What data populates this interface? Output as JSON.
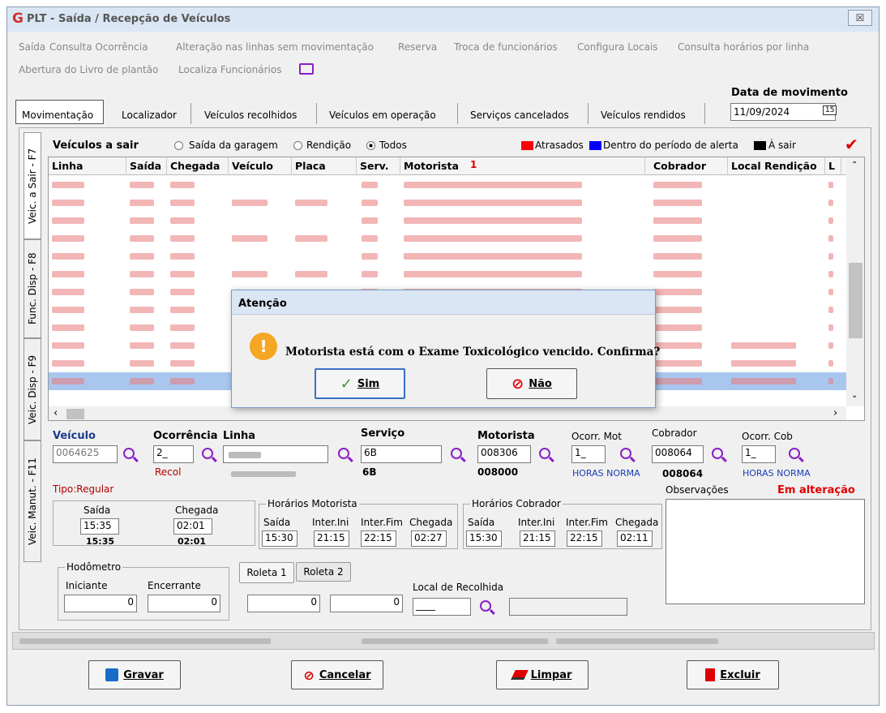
{
  "window": {
    "title": "PLT - Saída / Recepção de Veículos",
    "close": "☒"
  },
  "menu": {
    "row1": [
      "Saída",
      "Consulta Ocorrência",
      "Alteração nas linhas sem movimentação",
      "Reserva",
      "Troca de funcionários",
      "Configura Locais",
      "Consulta horários por linha"
    ],
    "row2": [
      "Abertura do Livro de plantão",
      "Localiza Funcionários"
    ]
  },
  "tabs": [
    "Movimentação",
    "Localizador",
    "Veículos recolhidos",
    "Veículos em operação",
    "Serviços cancelados",
    "Veículos rendidos"
  ],
  "data_movimento": {
    "label": "Data de movimento",
    "value": "11/09/2024",
    "btn": "15"
  },
  "side_tabs": [
    "Veic. a Sair - F7",
    "Func. Disp - F8",
    "Veic. Disp - F9",
    "Veic. Manut. - F11"
  ],
  "grid": {
    "title": "Veículos a sair",
    "radio_saida": "Saída da garagem",
    "radio_rendicao": "Rendição",
    "radio_todos": "Todos",
    "legend_atrasados": "Atrasados",
    "legend_dentro": "Dentro do período de alerta",
    "legend_sair": "À sair",
    "colors": {
      "atrasados": "#ff0000",
      "dentro": "#0000ff",
      "sair": "#000000",
      "selected": "#a9c7ee"
    },
    "headers": {
      "linha": "Linha",
      "saida": "Saída",
      "chegada": "Chegada",
      "veiculo": "Veículo",
      "placa": "Placa",
      "serv": "Serv.",
      "motorista": "Motorista",
      "sort": "1",
      "cobrador": "Cobrador",
      "local": "Local Rendição",
      "l": "L"
    }
  },
  "dialog": {
    "title": "Atenção",
    "message": "Motorista está com o Exame Toxicológico vencido. Confirma?",
    "yes": "Sim",
    "no": "Não",
    "icon": "!"
  },
  "form": {
    "veiculo_label": "Veículo",
    "veiculo": "0064625",
    "ocorrencia_label": "Ocorrência",
    "ocorrencia": "2_",
    "recol": "Recol",
    "linha_label": "Linha",
    "tipo": "Tipo:Regular",
    "servico_label": "Serviço",
    "servico": "6B",
    "servico_sub": "6B",
    "motorista_label": "Motorista",
    "motorista": "008306",
    "motorista_sub": "008000",
    "ocorr_mot_label": "Ocorr. Mot",
    "ocorr_mot": "1_",
    "horas_mot": "HORAS NORMA",
    "cobrador_label": "Cobrador",
    "cobrador": "008064",
    "cobrador_sub": "008064",
    "ocorr_cob_label": "Ocorr. Cob",
    "ocorr_cob": "1_",
    "horas_cob": "HORAS NORMA",
    "observacoes": "Observações",
    "em_alteracao": "Em alteração",
    "saida_label": "Saída",
    "saida": "15:35",
    "saida_sub": "15:35",
    "chegada_label": "Chegada",
    "chegada": "02:01",
    "chegada_sub": "02:01",
    "hm_label": "Horários Motorista",
    "hm_saida": "15:30",
    "hm_ini": "21:15",
    "hm_fim": "22:15",
    "hm_chegada": "02:27",
    "hc_label": "Horários Cobrador",
    "hc_saida": "15:30",
    "hc_ini": "21:15",
    "hc_fim": "22:15",
    "hc_chegada": "02:11",
    "col_saida": "Saída",
    "col_ini": "Inter.Ini",
    "col_fim": "Inter.Fim",
    "col_chegada": "Chegada",
    "hodometro": "Hodômetro",
    "iniciante": "Iniciante",
    "encerrante": "Encerrante",
    "iniciante_val": "0",
    "encerrante_val": "0",
    "roleta1": "Roleta 1",
    "roleta2": "Roleta 2",
    "roleta1_val": "0",
    "roleta2_val": "0",
    "local_recolhida": "Local de Recolhida",
    "local_val": "____"
  },
  "buttons": {
    "gravar": "Gravar",
    "cancelar": "Cancelar",
    "limpar": "Limpar",
    "excluir": "Excluir"
  }
}
